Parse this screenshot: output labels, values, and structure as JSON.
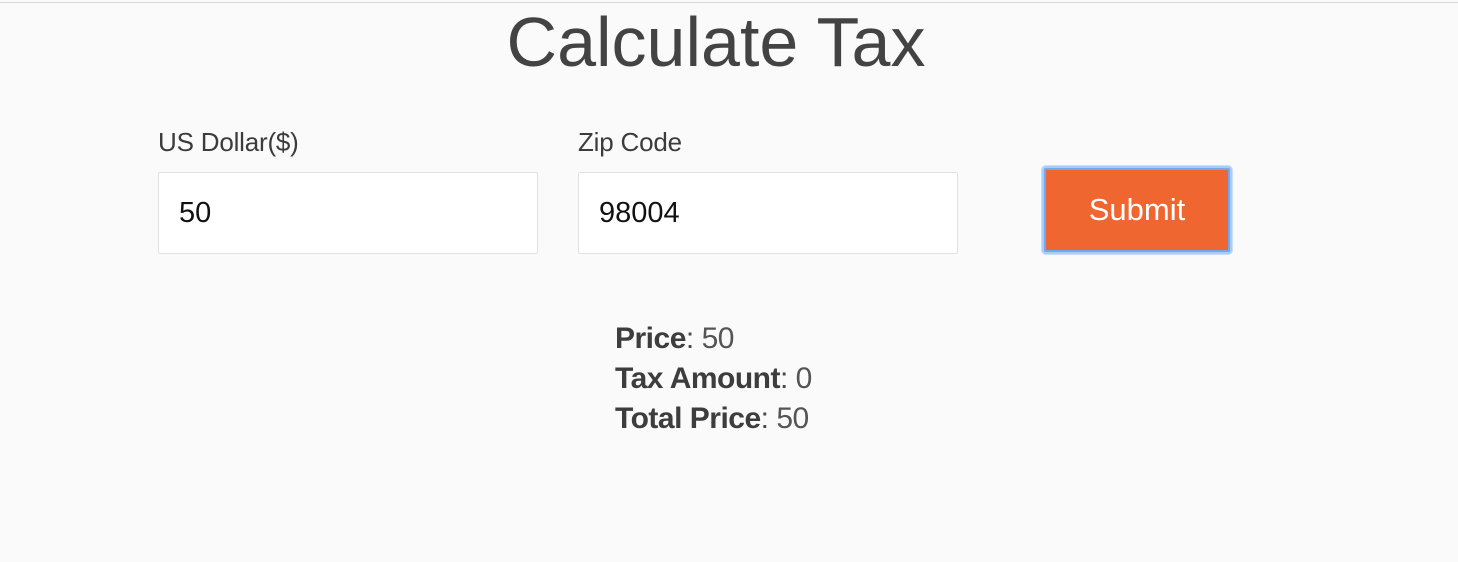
{
  "page": {
    "title": "Calculate Tax"
  },
  "form": {
    "usd_label": "US Dollar($)",
    "usd_value": "50",
    "zip_label": "Zip Code",
    "zip_value": "98004",
    "submit_label": "Submit"
  },
  "results": {
    "price_label": "Price",
    "price_value": "50",
    "tax_label": "Tax Amount",
    "tax_value": "0",
    "total_label": "Total Price",
    "total_value": "50"
  },
  "colors": {
    "accent": "#ef6630",
    "focus_ring": "#6fa9ef",
    "background": "#fafafa"
  }
}
